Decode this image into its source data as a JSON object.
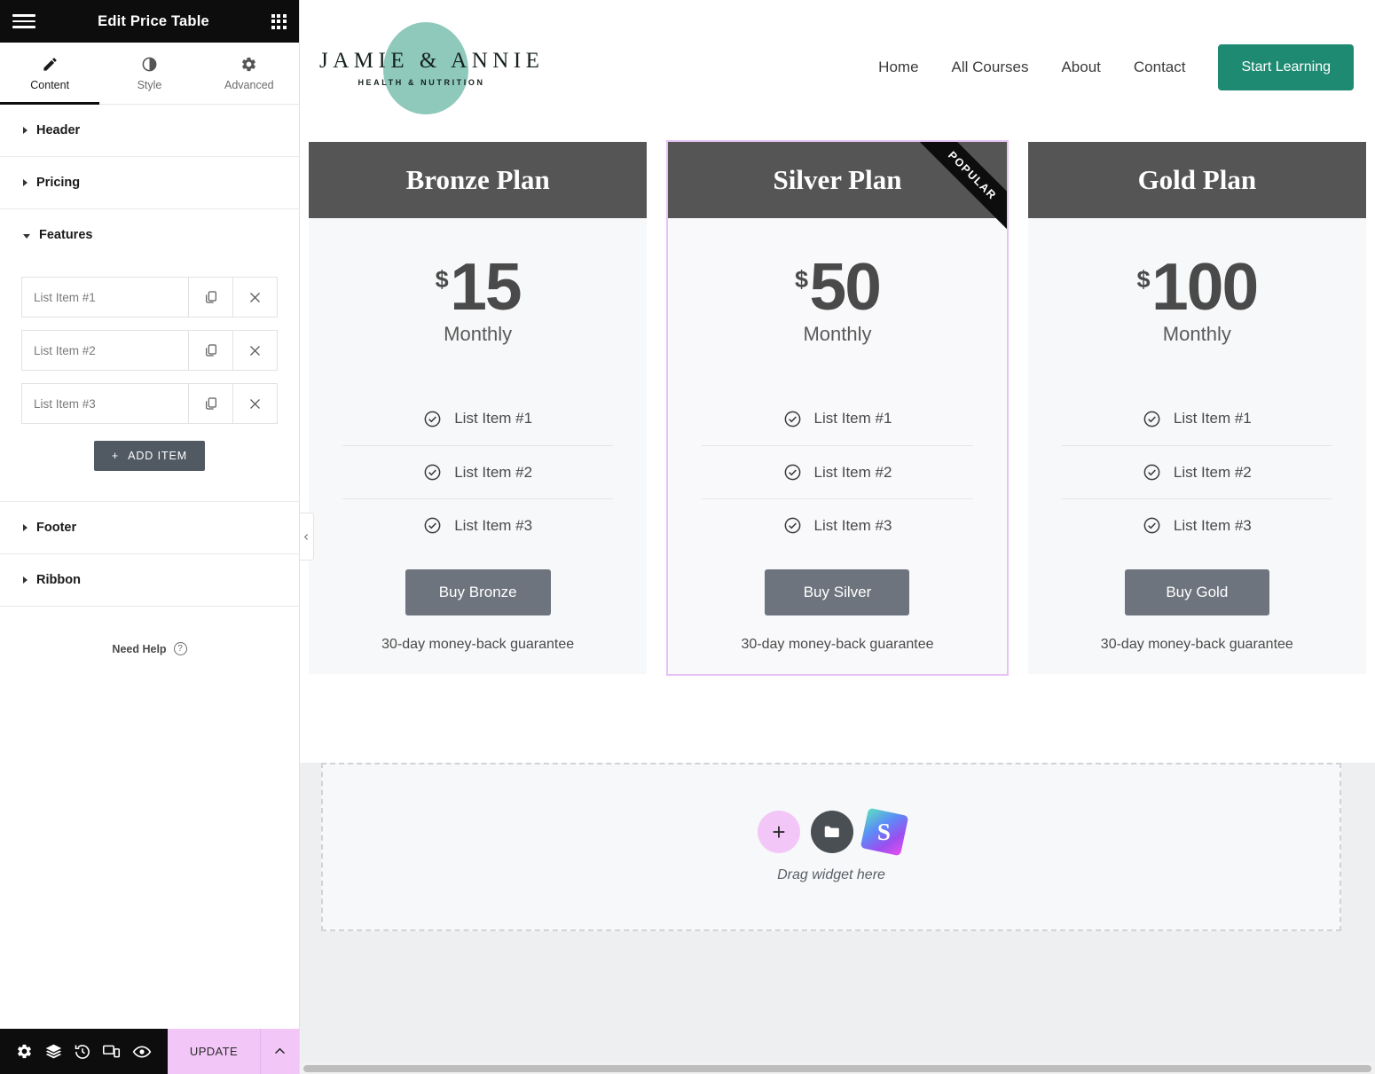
{
  "panel": {
    "title": "Edit Price Table",
    "menu_icon": "hamburger-icon",
    "apps_icon": "grid-apps-icon",
    "tabs": [
      {
        "label": "Content",
        "icon": "pencil-icon",
        "active": true
      },
      {
        "label": "Style",
        "icon": "contrast-icon",
        "active": false
      },
      {
        "label": "Advanced",
        "icon": "gear-icon",
        "active": false
      }
    ],
    "sections": [
      {
        "label": "Header",
        "open": false
      },
      {
        "label": "Pricing",
        "open": false
      },
      {
        "label": "Features",
        "open": true
      },
      {
        "label": "Footer",
        "open": false
      },
      {
        "label": "Ribbon",
        "open": false
      }
    ],
    "features_items": [
      {
        "value": "List Item #1",
        "duplicate_icon": "duplicate-icon",
        "remove_icon": "close-icon"
      },
      {
        "value": "List Item #2",
        "duplicate_icon": "duplicate-icon",
        "remove_icon": "close-icon"
      },
      {
        "value": "List Item #3",
        "duplicate_icon": "duplicate-icon",
        "remove_icon": "close-icon"
      }
    ],
    "add_item_label": "ADD ITEM",
    "add_item_plus": "+",
    "need_help_label": "Need Help",
    "need_help_icon": "question-circle-icon",
    "footer": {
      "icons": [
        "settings-gear-icon",
        "layers-navigator-icon",
        "history-icon",
        "responsive-mode-icon",
        "preview-eye-icon"
      ],
      "update_label": "UPDATE",
      "caret_icon": "chevron-up-icon"
    },
    "collapse_icon": "chevron-left-icon"
  },
  "site": {
    "logo": {
      "name": "JAMIE & ANNIE",
      "sub": "HEALTH & NUTRITION",
      "blob_color": "#8fc9bb"
    },
    "nav": [
      "Home",
      "All Courses",
      "About",
      "Contact"
    ],
    "cta": {
      "label": "Start Learning",
      "color": "#1f8a72"
    }
  },
  "pricing": {
    "cards": [
      {
        "title": "Bronze Plan",
        "currency": "$",
        "amount": "15",
        "period": "Monthly",
        "features": [
          "List Item #1",
          "List Item #2",
          "List Item #3"
        ],
        "button": "Buy Bronze",
        "guarantee": "30-day money-back guarantee",
        "ribbon": "",
        "selected": false
      },
      {
        "title": "Silver Plan",
        "currency": "$",
        "amount": "50",
        "period": "Monthly",
        "features": [
          "List Item #1",
          "List Item #2",
          "List Item #3"
        ],
        "button": "Buy Silver",
        "guarantee": "30-day money-back guarantee",
        "ribbon": "POPULAR",
        "selected": true
      },
      {
        "title": "Gold Plan",
        "currency": "$",
        "amount": "100",
        "period": "Monthly",
        "features": [
          "List Item #1",
          "List Item #2",
          "List Item #3"
        ],
        "button": "Buy Gold",
        "guarantee": "30-day money-back guarantee",
        "ribbon": "",
        "selected": false
      }
    ]
  },
  "dropzone": {
    "label": "Drag widget here",
    "add_icon": "+",
    "folder_icon": "folder-icon",
    "shapes_icon": "S"
  }
}
